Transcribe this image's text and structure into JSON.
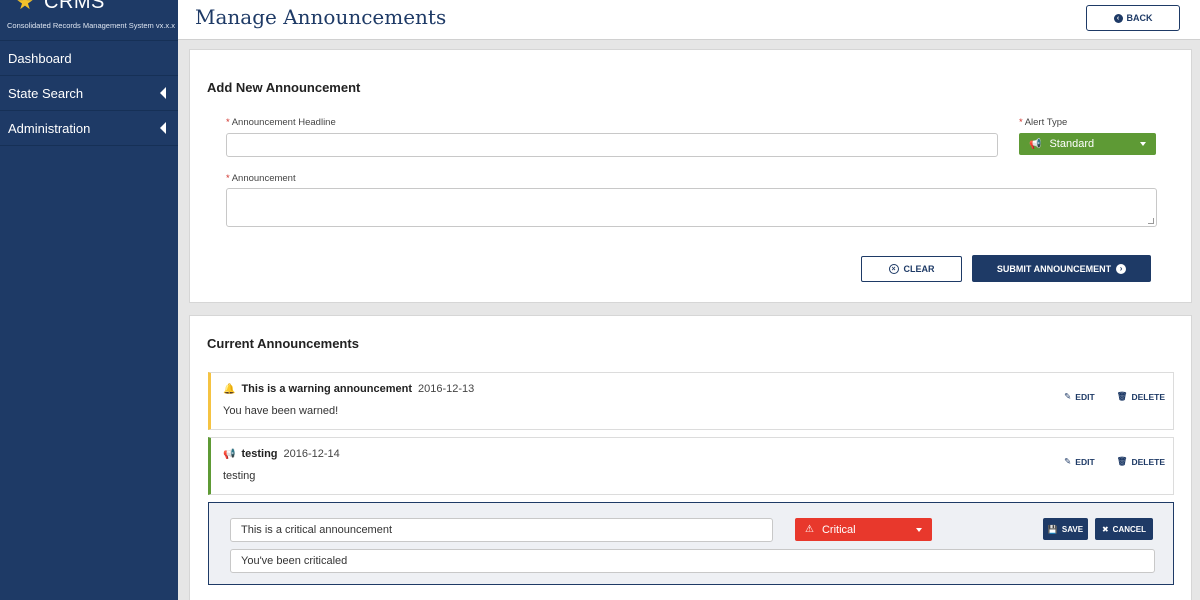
{
  "brand": {
    "logo": "CRMS",
    "subtitle": "Consolidated Records Management System vx.x.x"
  },
  "sidebar": {
    "items": [
      {
        "label": "Dashboard"
      },
      {
        "label": "State Search"
      },
      {
        "label": "Administration"
      }
    ]
  },
  "header": {
    "title": "Manage Announcements",
    "back_label": "BACK"
  },
  "add_form": {
    "title": "Add New Announcement",
    "headline_label": "Announcement Headline",
    "headline_value": "",
    "alert_type_label": "Alert Type",
    "alert_type_value": "Standard",
    "announcement_label": "Announcement",
    "announcement_value": "",
    "clear_label": "CLEAR",
    "submit_label": "SUBMIT ANNOUNCEMENT",
    "required_mark": "*"
  },
  "current": {
    "title": "Current Announcements",
    "items": [
      {
        "headline": "This is a warning announcement",
        "date": "2016-12-13",
        "body": "You have been warned!",
        "type": "warning",
        "icon": "bell-icon",
        "accent": "#f5c342"
      },
      {
        "headline": "testing",
        "date": "2016-12-14",
        "body": "testing",
        "type": "standard",
        "icon": "megaphone-icon",
        "accent": "#5e9a35"
      }
    ],
    "edit_label": "EDIT",
    "delete_label": "DELETE",
    "editing": {
      "headline_value": "This is a critical announcement",
      "body_value": "You've been criticaled",
      "alert_type_value": "Critical",
      "save_label": "SAVE",
      "cancel_label": "CANCEL"
    }
  },
  "colors": {
    "navy": "#1e3a66",
    "standard": "#5e9a35",
    "critical": "#e8382c",
    "warning": "#f5c342",
    "required": "#d0302a"
  }
}
